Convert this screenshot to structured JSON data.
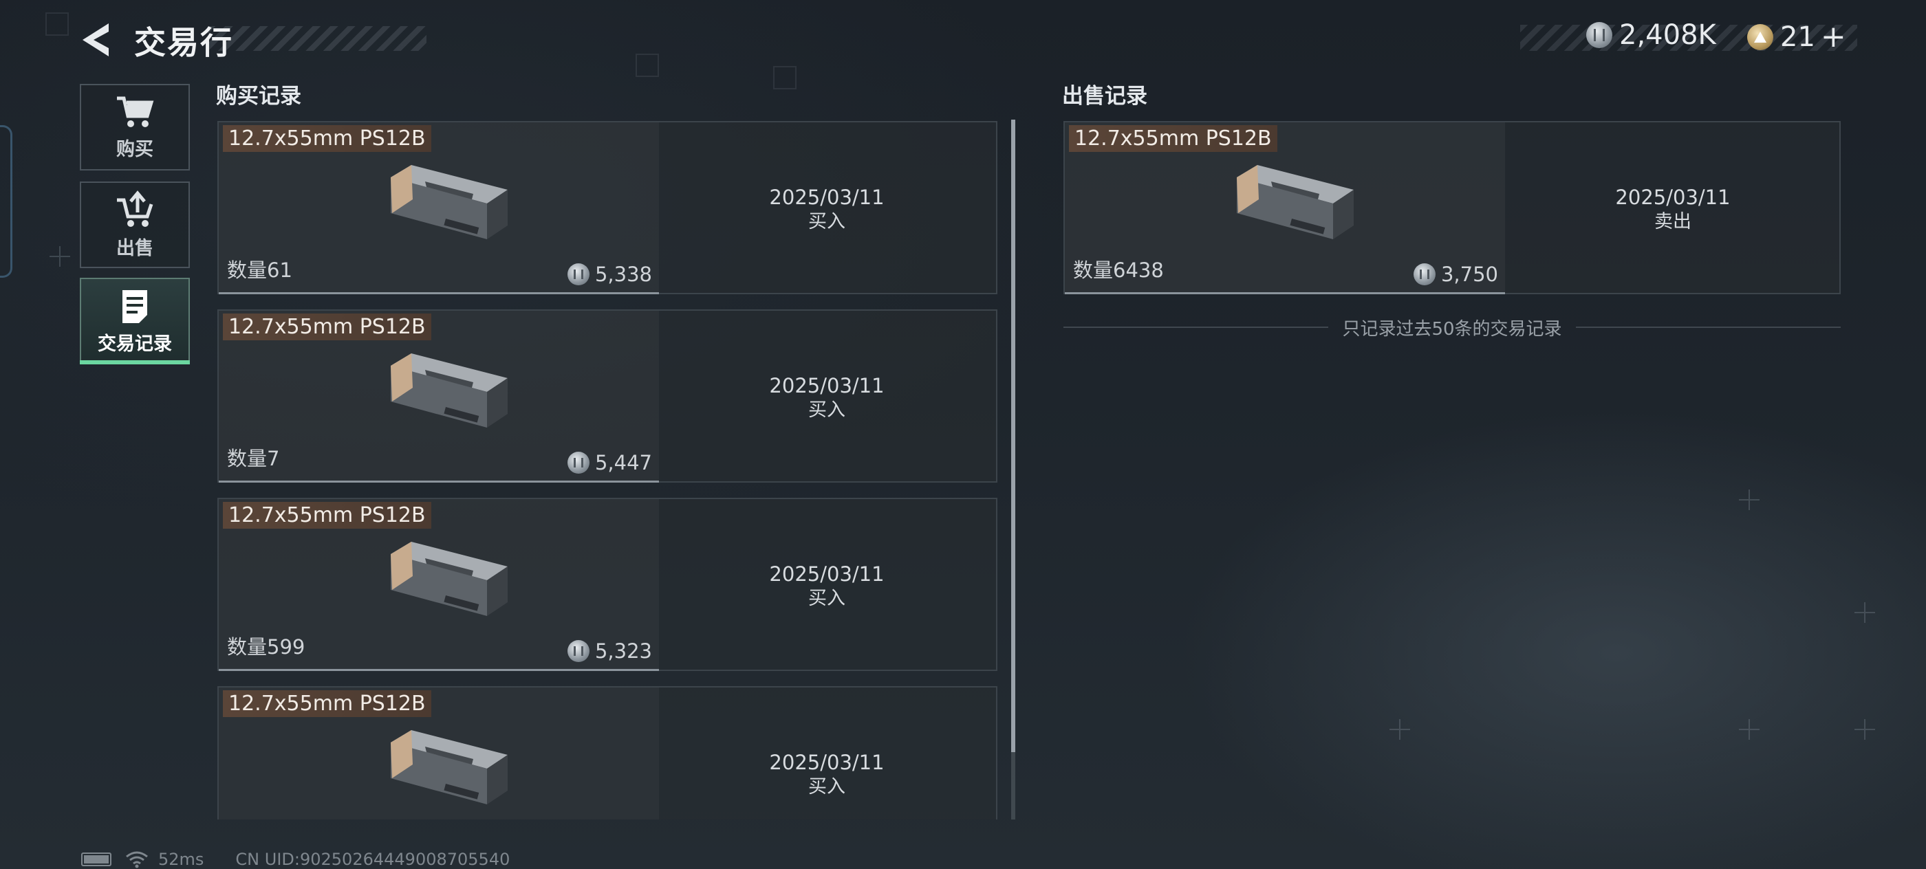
{
  "header": {
    "title": "交易行",
    "currency_silver": "2,408K",
    "currency_gold": "21"
  },
  "sidebar": {
    "items": [
      {
        "label": "购买",
        "icon": "cart-icon",
        "active": false
      },
      {
        "label": "出售",
        "icon": "sell-cart-icon",
        "active": false
      },
      {
        "label": "交易记录",
        "icon": "record-icon",
        "active": true
      }
    ]
  },
  "buy_section": {
    "heading": "购买记录",
    "records": [
      {
        "name": "12.7x55mm PS12B",
        "quantity": "数量61",
        "price": "5,338",
        "date": "2025/03/11",
        "type": "买入"
      },
      {
        "name": "12.7x55mm PS12B",
        "quantity": "数量7",
        "price": "5,447",
        "date": "2025/03/11",
        "type": "买入"
      },
      {
        "name": "12.7x55mm PS12B",
        "quantity": "数量599",
        "price": "5,323",
        "date": "2025/03/11",
        "type": "买入"
      },
      {
        "name": "12.7x55mm PS12B",
        "quantity": "",
        "price": "",
        "date": "2025/03/11",
        "type": "买入"
      }
    ]
  },
  "sell_section": {
    "heading": "出售记录",
    "records": [
      {
        "name": "12.7x55mm PS12B",
        "quantity": "数量6438",
        "price": "3,750",
        "date": "2025/03/11",
        "type": "卖出"
      }
    ],
    "note": "只记录过去50条的交易记录"
  },
  "status_bar": {
    "ping": "52ms",
    "uid": "CN UID:90250264449008705540"
  },
  "colors": {
    "accent_green": "#6bd6a0",
    "name_tag": "#5a4538"
  }
}
